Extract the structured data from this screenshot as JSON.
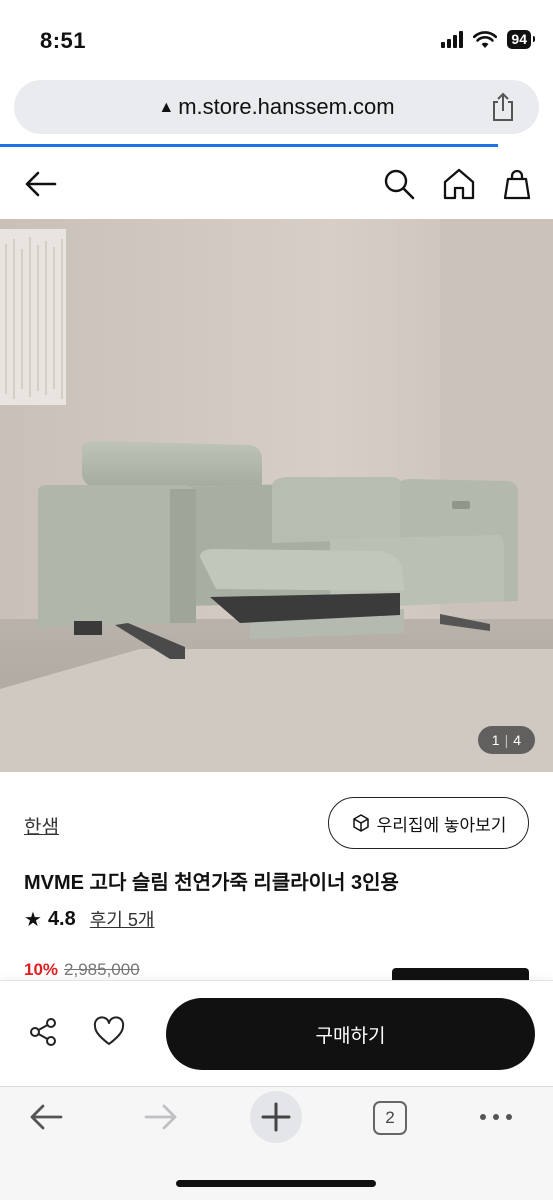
{
  "status_bar": {
    "time": "8:51",
    "battery": "94"
  },
  "browser": {
    "url": "m.store.hanssem.com",
    "url_warning_icon": "warning-triangle-icon",
    "tab_count": "2",
    "accent_color": "#1a73e8"
  },
  "hero": {
    "page_current": "1",
    "page_total": "4"
  },
  "product": {
    "brand": "한샘",
    "ar_button_label": "우리집에 놓아보기",
    "name": "MVME 고다 슬림 천연가죽 리클라이너 3인용",
    "rating": "4.8",
    "reviews_label": "후기 5개",
    "discount": "10%",
    "original_price": "2,985,000",
    "discount_color": "#e02020"
  },
  "buy_bar": {
    "buy_label": "구매하기"
  }
}
